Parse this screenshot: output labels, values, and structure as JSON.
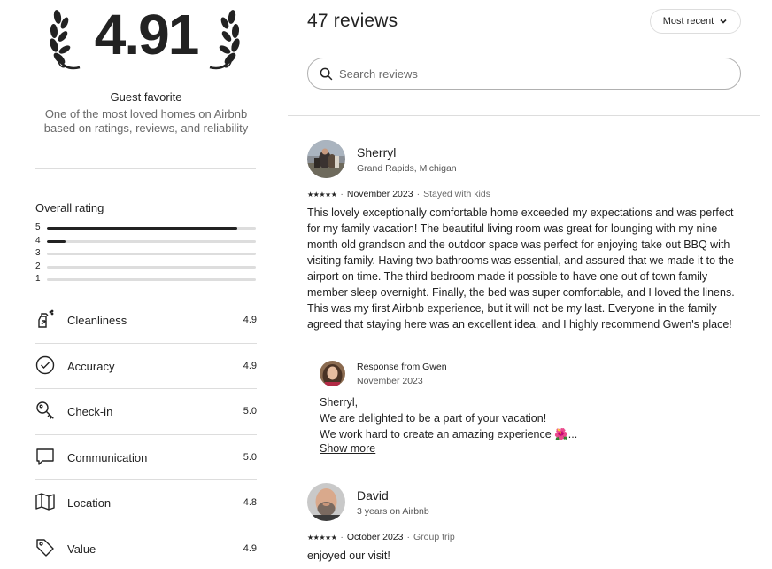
{
  "summary": {
    "rating": "4.91",
    "guest_favorite_label": "Guest favorite",
    "guest_favorite_desc": "One of the most loved homes on Airbnb based on ratings, reviews, and reliability"
  },
  "overall_rating": {
    "title": "Overall rating",
    "distribution": [
      {
        "label": "5",
        "fraction": 0.91
      },
      {
        "label": "4",
        "fraction": 0.09
      },
      {
        "label": "3",
        "fraction": 0.0
      },
      {
        "label": "2",
        "fraction": 0.0
      },
      {
        "label": "1",
        "fraction": 0.0
      }
    ]
  },
  "categories": [
    {
      "name": "Cleanliness",
      "value": "4.9",
      "icon": "spray-bottle-icon"
    },
    {
      "name": "Accuracy",
      "value": "4.9",
      "icon": "check-circle-icon"
    },
    {
      "name": "Check-in",
      "value": "5.0",
      "icon": "key-icon"
    },
    {
      "name": "Communication",
      "value": "5.0",
      "icon": "message-icon"
    },
    {
      "name": "Location",
      "value": "4.8",
      "icon": "map-icon"
    },
    {
      "name": "Value",
      "value": "4.9",
      "icon": "tag-icon"
    }
  ],
  "header": {
    "review_count": "47 reviews",
    "sort_label": "Most recent"
  },
  "search": {
    "placeholder": "Search reviews"
  },
  "reviews": [
    {
      "name": "Sherryl",
      "subtitle": "Grand Rapids, Michigan",
      "stars": "★★★★★",
      "date": "November 2023",
      "trip": "Stayed with kids",
      "text": "This lovely exceptionally comfortable home exceeded my expectations and was perfect for my family vacation! The beautiful living room was great for lounging with my nine month old grandson and the outdoor space was perfect for enjoying take out BBQ with visiting family. Having two bathrooms was essential, and assured that we made it to the airport on time. The third bedroom made it possible to have one out of town family member sleep overnight. Finally, the bed was super comfortable, and I loved the linens. This was my first Airbnb experience, but it will not be my last. Everyone in the family agreed that staying here was an excellent idea, and I highly recommend Gwen's place!",
      "response": {
        "title": "Response from Gwen",
        "date": "November 2023",
        "line1": "Sherryl,",
        "line2": "We are delighted to be a part of your vacation!",
        "line3": "We work hard to create an amazing experience 🌺...",
        "show_more": "Show more"
      }
    },
    {
      "name": "David",
      "subtitle": "3 years on Airbnb",
      "stars": "★★★★★",
      "date": "October 2023",
      "trip": "Group trip",
      "text": "enjoyed our visit!"
    }
  ],
  "meta_separator": "·",
  "colors": {
    "text": "#222222",
    "muted": "#6a6a6a",
    "divider": "#dddddd",
    "bar_fill": "#222222"
  }
}
